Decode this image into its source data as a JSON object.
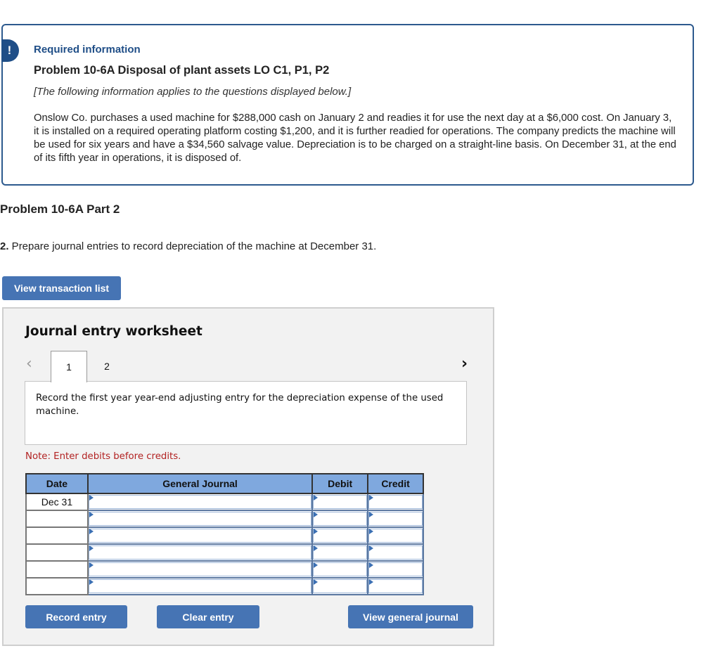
{
  "info": {
    "badge": "!",
    "required_label": "Required information",
    "problem_title": "Problem 10-6A Disposal of plant assets LO C1, P1, P2",
    "applies_note": "[The following information applies to the questions displayed below.]",
    "body": "Onslow Co. purchases a used machine for $288,000 cash on January 2 and readies it for use the next day at a $6,000 cost. On January 3, it is installed on a required operating platform costing $1,200, and it is further readied for operations. The company predicts the machine will be used for six years and have a $34,560 salvage value. Depreciation is to be charged on a straight-line basis. On December 31, at the end of its fifth year in operations, it is disposed of."
  },
  "part": {
    "title": "Problem 10-6A Part 2",
    "question_number": "2.",
    "question_text": " Prepare journal entries to record depreciation of the machine at December 31."
  },
  "buttons": {
    "view_transaction_list": "View transaction list",
    "record_entry": "Record entry",
    "clear_entry": "Clear entry",
    "view_general_journal": "View general journal"
  },
  "worksheet": {
    "title": "Journal entry worksheet",
    "prev_icon": "‹",
    "next_icon": "›",
    "tabs": [
      "1",
      "2"
    ],
    "active_tab": "1",
    "description": "Record the first year year-end adjusting entry for the depreciation expense of the used machine.",
    "note": "Note: Enter debits before credits.",
    "columns": [
      "Date",
      "General Journal",
      "Debit",
      "Credit"
    ],
    "rows": [
      {
        "date": "Dec 31",
        "account": "",
        "debit": "",
        "credit": ""
      },
      {
        "date": "",
        "account": "",
        "debit": "",
        "credit": ""
      },
      {
        "date": "",
        "account": "",
        "debit": "",
        "credit": ""
      },
      {
        "date": "",
        "account": "",
        "debit": "",
        "credit": ""
      },
      {
        "date": "",
        "account": "",
        "debit": "",
        "credit": ""
      },
      {
        "date": "",
        "account": "",
        "debit": "",
        "credit": ""
      }
    ]
  },
  "colors": {
    "brand_blue": "#1f4e87",
    "button_blue": "#4674b4",
    "header_blue": "#7fa8de",
    "note_red": "#b22222"
  }
}
